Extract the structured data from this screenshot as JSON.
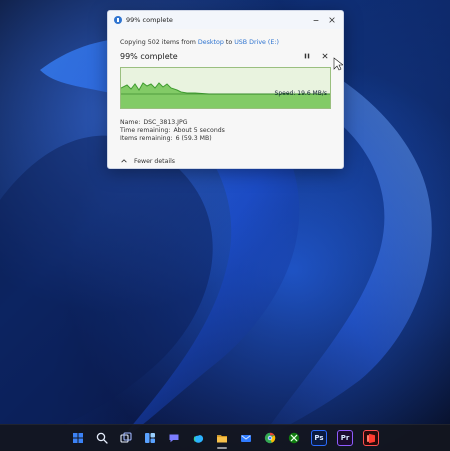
{
  "dialog": {
    "title": "99% complete",
    "copy_prefix": "Copying 502 items from ",
    "copy_source": "Desktop",
    "copy_mid": " to ",
    "copy_dest": "USB Drive (E:)",
    "main_status": "99% complete",
    "speed_label": "Speed: 19.6 MB/s",
    "progress_percent": 99,
    "name_label": "Name:",
    "name_value": "DSC_3813.JPG",
    "time_label": "Time remaining:",
    "time_value": "About 5 seconds",
    "items_label": "Items remaining:",
    "items_value": "6 (59.3 MB)",
    "fewer_details_label": "Fewer details",
    "colors": {
      "graph_fill": "#76c55a",
      "graph_bg": "#e9f3df",
      "link": "#2f74d0"
    }
  },
  "taskbar": {
    "icons": [
      {
        "name": "windows-start-icon"
      },
      {
        "name": "search-icon"
      },
      {
        "name": "task-view-icon"
      },
      {
        "name": "widgets-icon"
      },
      {
        "name": "teams-chat-icon"
      },
      {
        "name": "edge-icon"
      },
      {
        "name": "file-explorer-icon",
        "active": true
      },
      {
        "name": "mail-icon"
      },
      {
        "name": "chrome-icon"
      },
      {
        "name": "xbox-icon"
      },
      {
        "name": "photoshop-icon",
        "text": "Ps"
      },
      {
        "name": "premiere-icon",
        "text": "Pr"
      },
      {
        "name": "office-icon"
      }
    ]
  }
}
